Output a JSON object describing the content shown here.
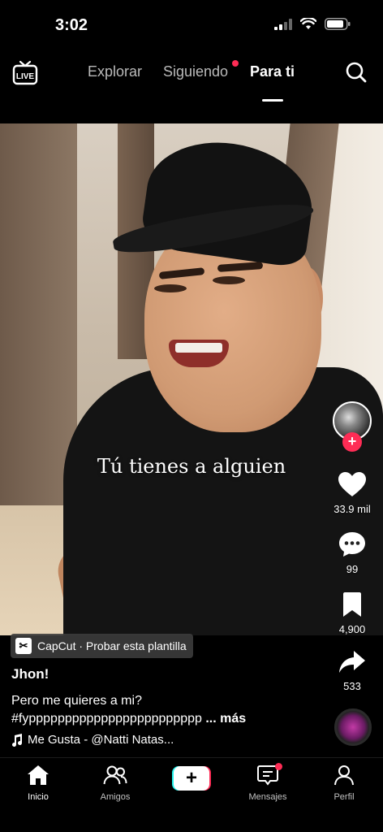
{
  "status": {
    "time": "3:02"
  },
  "nav": {
    "live_label": "LIVE",
    "tabs": [
      {
        "label": "Explorar"
      },
      {
        "label": "Siguiendo"
      },
      {
        "label": "Para ti"
      }
    ],
    "active_tab": "Para ti",
    "siguiendo_has_dot": true
  },
  "video": {
    "caption_text": "Tú tienes a alguien"
  },
  "rail": {
    "likes": "33.9 mil",
    "comments": "99",
    "saves": "4,900",
    "shares": "533"
  },
  "post": {
    "template_chip": "CapCut · Probar esta plantilla",
    "template_logo": "✂",
    "username": "Jhon!",
    "description_line1": "Pero me quieres a mi?",
    "description_line2": "#fypppppppppppppppppppppppp",
    "more_label": "... más",
    "music": "Me Gusta - @Natti Natas..."
  },
  "tabbar": {
    "items": [
      {
        "label": "Inicio"
      },
      {
        "label": "Amigos"
      },
      {
        "label": ""
      },
      {
        "label": "Mensajes"
      },
      {
        "label": "Perfil"
      }
    ],
    "create_symbol": "+",
    "active": "Inicio"
  },
  "colors": {
    "accent": "#fe2c55",
    "cyan": "#25f4ee",
    "background": "#000000"
  },
  "icons": [
    "live-icon",
    "search-icon",
    "heart-icon",
    "comment-icon",
    "bookmark-icon",
    "share-icon",
    "music-note-icon",
    "home-icon",
    "friends-icon",
    "inbox-icon",
    "profile-icon"
  ]
}
